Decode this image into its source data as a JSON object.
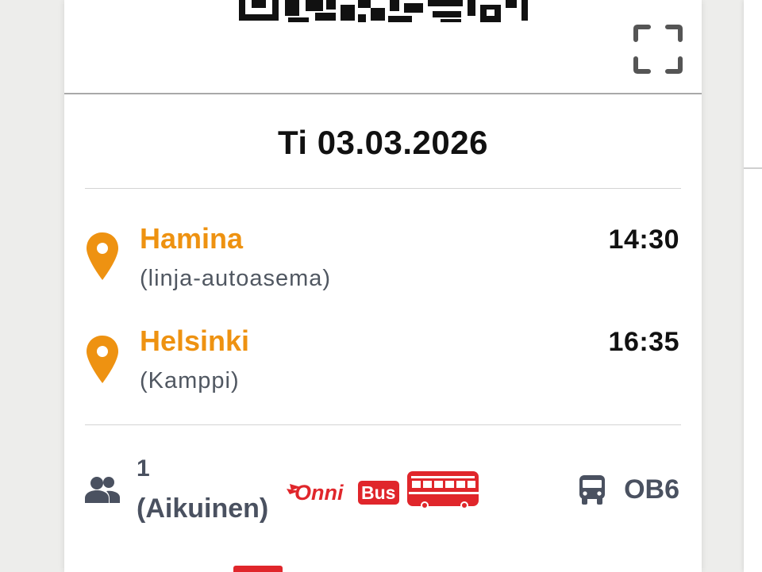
{
  "ticket": {
    "date": "Ti 03.03.2026",
    "departure": {
      "city": "Hamina",
      "station": "(linja-autoasema)",
      "time": "14:30"
    },
    "arrival": {
      "city": "Helsinki",
      "station": "(Kamppi)",
      "time": "16:35"
    },
    "passengers": {
      "count": "1",
      "type": "(Aikuinen)"
    },
    "operator": {
      "logo_text": "OnniBus"
    },
    "line": {
      "code": "OB6"
    }
  },
  "icons": {
    "qr": "qr-code",
    "fullscreen": "fullscreen-icon",
    "pin": "location-pin-icon",
    "people": "people-icon",
    "bus": "bus-icon"
  },
  "colors": {
    "accent": "#ee9211",
    "brand_red": "#e0262b",
    "text_dark": "#111111",
    "text_muted": "#4a5160"
  }
}
